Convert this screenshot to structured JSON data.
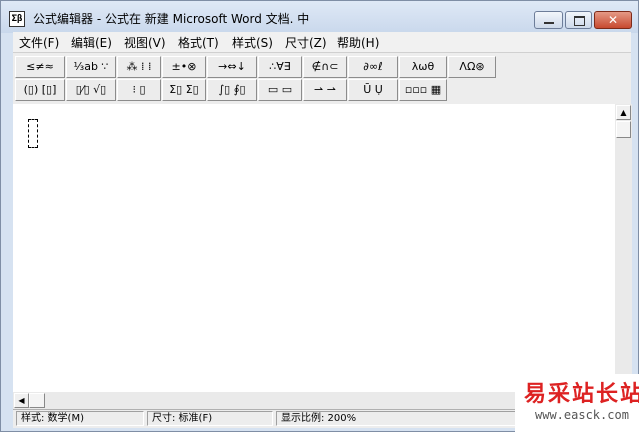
{
  "window": {
    "app_icon_text": "Σβ",
    "title": "公式编辑器 - 公式在 新建 Microsoft Word 文档. 中",
    "close_glyph": "✕"
  },
  "menu": [
    "文件(F)",
    "编辑(E)",
    "视图(V)",
    "格式(T)",
    "样式(S)",
    "尺寸(Z)",
    "帮助(H)"
  ],
  "palette": {
    "row1": [
      "≤≠≈",
      "⅓ab ∵",
      "⁂ ⁞ ⁞",
      "±•⊗",
      "→⇔↓",
      "∴∀∃",
      "∉∩⊂",
      "∂∞ℓ",
      "λωθ",
      "ΛΩ⊛"
    ],
    "row2": [
      "(▯) [▯]",
      "▯⁄▯ √▯",
      "⁝ ▯",
      "Σ▯ Σ▯",
      "∫▯ ∮▯",
      "▭ ▭",
      "⇀ ⇀",
      "Ū Ụ",
      "▫▫▫ ▦"
    ]
  },
  "scroll": {
    "up": "▲",
    "down": "▼",
    "left": "◀"
  },
  "status": {
    "style": "样式: 数学(M)",
    "size": "尺寸: 标准(F)",
    "zoom": "显示比例: 200%"
  },
  "watermark": {
    "logo": "易采站长站",
    "url": "www.easck.com"
  }
}
